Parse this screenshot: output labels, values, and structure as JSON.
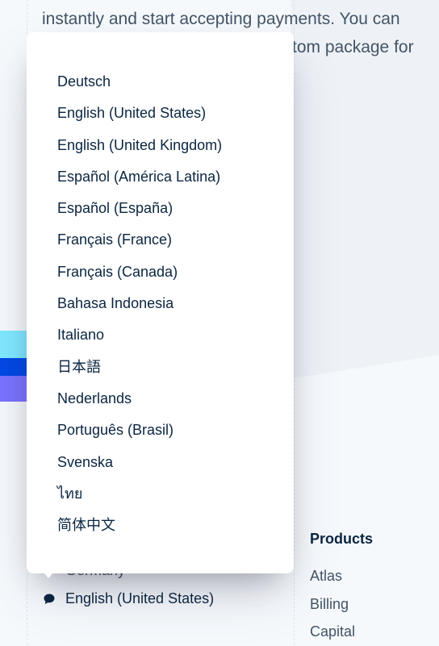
{
  "intro": {
    "line1": "instantly and start accepting payments. You can",
    "line2": "tom package for"
  },
  "footer": {
    "country": "Germany",
    "language": "English (United States)",
    "language_icon": "speech-bubble-icon"
  },
  "products": {
    "title": "Products",
    "items": [
      "Atlas",
      "Billing",
      "Capital"
    ]
  },
  "language_menu": {
    "options": [
      "Deutsch",
      "English (United States)",
      "English (United Kingdom)",
      "Español (América Latina)",
      "Español (España)",
      "Français (France)",
      "Français (Canada)",
      "Bahasa Indonesia",
      "Italiano",
      "日本語",
      "Nederlands",
      "Português (Brasil)",
      "Svenska",
      "ไทย",
      "简体中文"
    ]
  },
  "colors": {
    "accent_cyan": "#80e9ff",
    "accent_blue": "#0048e5",
    "accent_purple": "#7a73ff",
    "text_dark": "#0a2540",
    "text_muted": "#425466"
  }
}
